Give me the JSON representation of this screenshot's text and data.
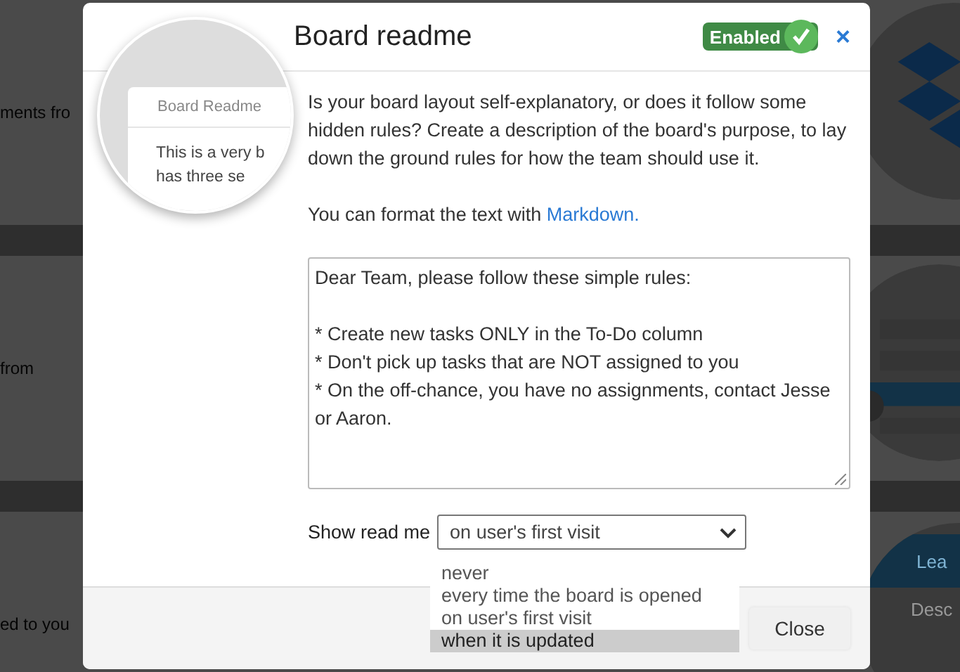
{
  "background": {
    "texts": [
      "ments fro",
      "from",
      "ed to you"
    ],
    "panel": {
      "title": "Lea",
      "text": "Desc"
    }
  },
  "dialog": {
    "title": "Board readme",
    "preview": {
      "title": "Board Readme",
      "lines": [
        "This is a very b",
        "has three se"
      ]
    },
    "status": {
      "label": "Enabled",
      "enabled": true
    },
    "close_icon": "×",
    "intro": "Is your board layout self-explanatory, or does it follow some hidden rules? Create a description of the board's purpose, to lay down the ground rules for how the team should use it.",
    "format_note": "You can format the text with ",
    "format_link": "Markdown.",
    "readme_text": "Dear Team, please follow these simple rules:\n\n* Create new tasks ONLY in the To-Do column\n* Don't pick up tasks that are NOT assigned to you\n* On the off-chance, you have no assignments, contact Jesse or Aaron.",
    "show_label": "Show read me",
    "show_value": "on user's first visit",
    "options": [
      {
        "label": "never",
        "highlighted": false
      },
      {
        "label": "every time the board is opened",
        "highlighted": false
      },
      {
        "label": "on user's first visit",
        "highlighted": false
      },
      {
        "label": "when it is updated",
        "highlighted": true
      }
    ],
    "footer_button": "Close"
  }
}
